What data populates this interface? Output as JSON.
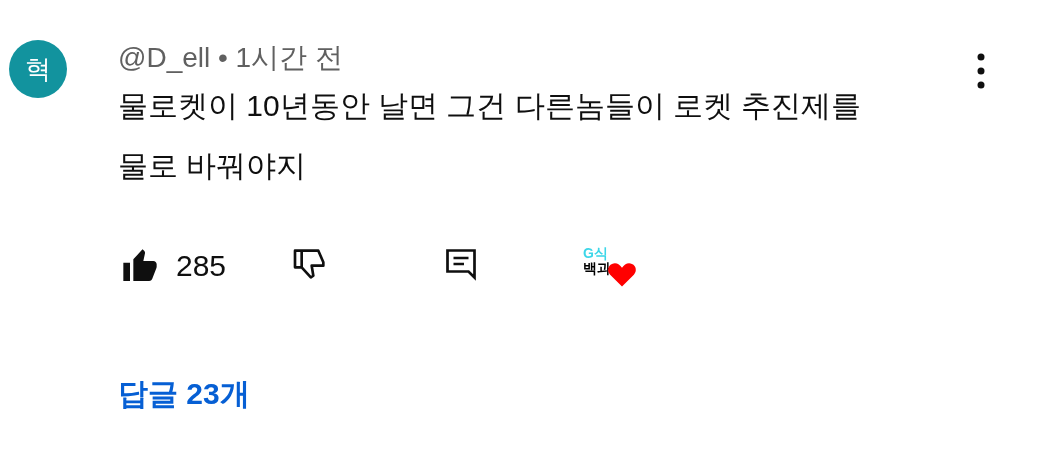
{
  "comment": {
    "avatar_letter": "혁",
    "author": "@D_ell",
    "separator": "•",
    "time": "1시간 전",
    "text": "물로켓이 10년동안 날면 그건 다른놈들이 로켓 추진제를 물로 바꿔야지",
    "liked": true,
    "disliked": false,
    "like_count": "285",
    "creator_heart": {
      "logo_lines": [
        "G식",
        "백과"
      ]
    }
  },
  "replies_link": "답글 23개"
}
